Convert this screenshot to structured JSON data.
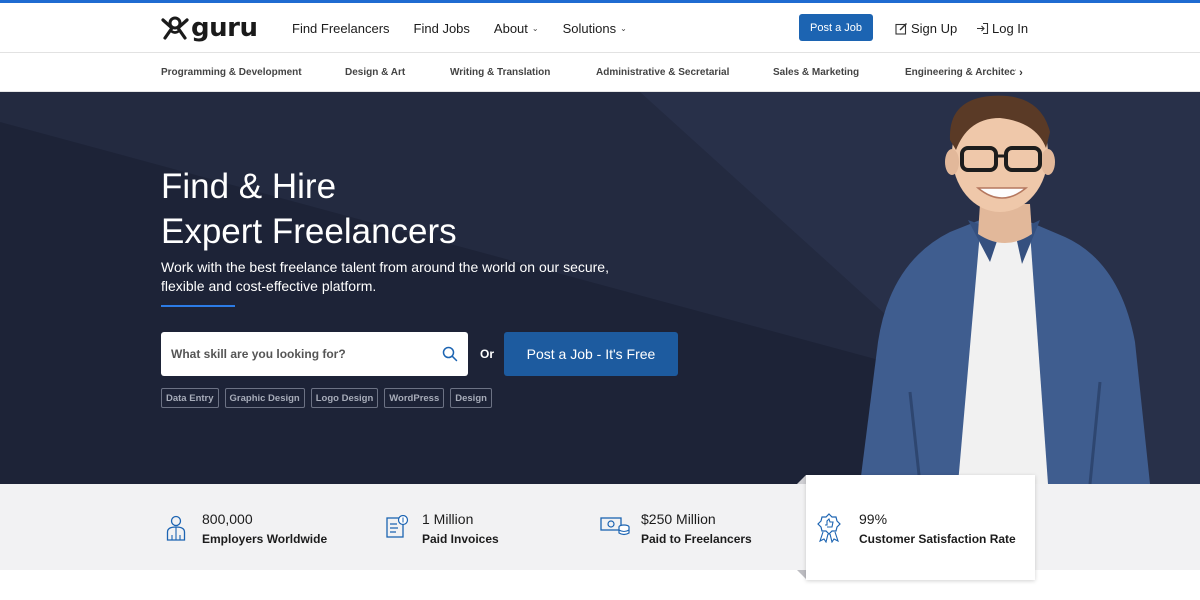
{
  "header": {
    "logo_text": "guru",
    "nav": [
      {
        "label": "Find Freelancers"
      },
      {
        "label": "Find Jobs"
      },
      {
        "label": "About",
        "dropdown": true
      },
      {
        "label": "Solutions",
        "dropdown": true
      }
    ],
    "post_job_label": "Post a Job",
    "signup_label": "Sign Up",
    "login_label": "Log In"
  },
  "categories": [
    "Programming & Development",
    "Design & Art",
    "Writing & Translation",
    "Administrative & Secretarial",
    "Sales & Marketing",
    "Engineering & Architect"
  ],
  "categories_more_icon": "chevron-right-icon",
  "hero": {
    "title_line1": "Find & Hire",
    "title_line2": "Expert Freelancers",
    "subtitle_line1": "Work with the best freelance talent from around the world on our secure,",
    "subtitle_line2": "flexible and cost-effective platform.",
    "search_placeholder": "What skill are you looking for?",
    "or_label": "Or",
    "post_job_free_label": "Post a Job - It's Free",
    "tags": [
      "Data Entry",
      "Graphic Design",
      "Logo Design",
      "WordPress",
      "Design"
    ]
  },
  "stats": [
    {
      "value": "800,000",
      "label": "Employers Worldwide",
      "icon": "employer-icon"
    },
    {
      "value": "1 Million",
      "label": "Paid Invoices",
      "icon": "invoice-icon"
    },
    {
      "value": "$250 Million",
      "label": "Paid to Freelancers",
      "icon": "money-icon"
    },
    {
      "value": "99%",
      "label": "Customer Satisfaction Rate",
      "icon": "award-badge-icon"
    }
  ],
  "colors": {
    "accent": "#1c64b2",
    "hero_bg": "#232a40",
    "hero_button": "#1d5b9f",
    "stats_bg": "#f2f2f3"
  }
}
